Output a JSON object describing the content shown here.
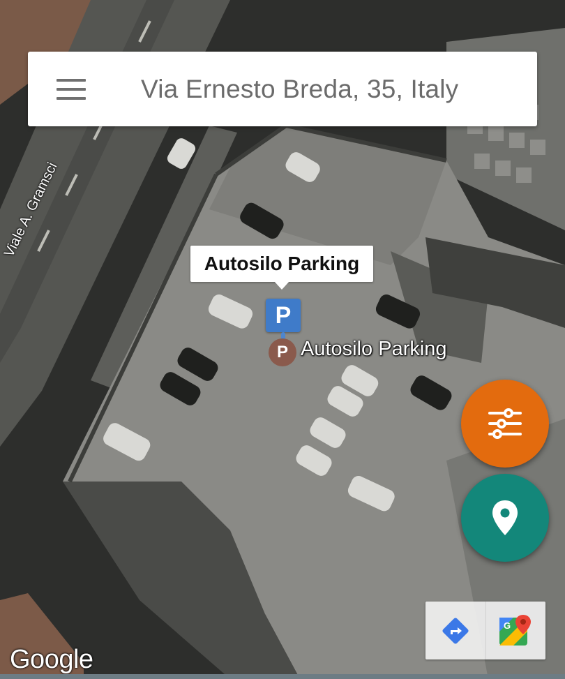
{
  "search": {
    "query": "Via Ernesto Breda, 35, Italy"
  },
  "map": {
    "callout_title": "Autosilo Parking",
    "marker_letter": "P",
    "poi_icon_letter": "P",
    "poi_label": "Autosilo Parking",
    "street_label": "Viale A. Gramsci",
    "attribution": "Google"
  },
  "fabs": {
    "filter_color": "#e36b0e",
    "location_color": "#13877a"
  },
  "toolbar": {
    "directions_icon": "directions-icon",
    "maps_icon": "google-maps-icon"
  }
}
